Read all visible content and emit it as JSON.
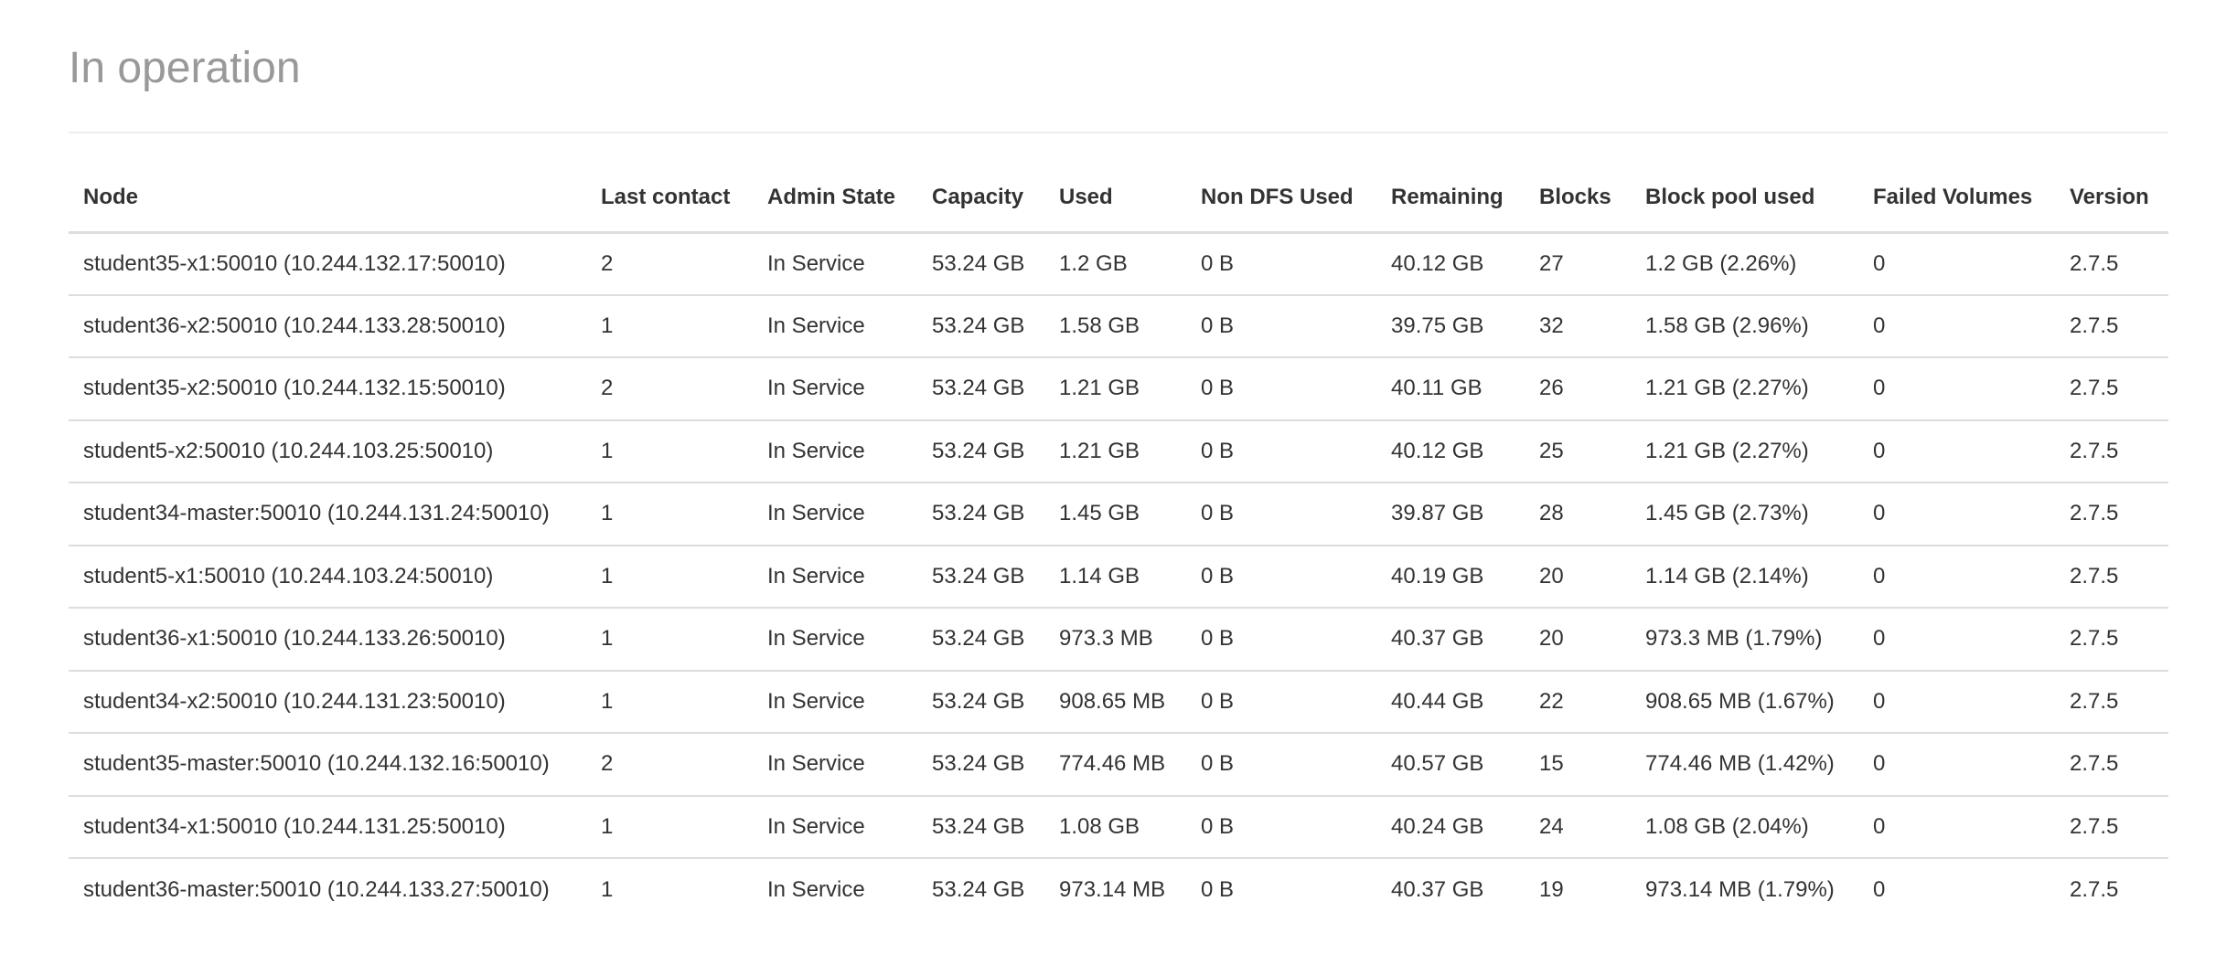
{
  "section": {
    "title": "In operation"
  },
  "table": {
    "columns": [
      "Node",
      "Last contact",
      "Admin State",
      "Capacity",
      "Used",
      "Non DFS Used",
      "Remaining",
      "Blocks",
      "Block pool used",
      "Failed Volumes",
      "Version"
    ],
    "rows": [
      [
        "student35-x1:50010 (10.244.132.17:50010)",
        "2",
        "In Service",
        "53.24 GB",
        "1.2 GB",
        "0 B",
        "40.12 GB",
        "27",
        "1.2 GB (2.26%)",
        "0",
        "2.7.5"
      ],
      [
        "student36-x2:50010 (10.244.133.28:50010)",
        "1",
        "In Service",
        "53.24 GB",
        "1.58 GB",
        "0 B",
        "39.75 GB",
        "32",
        "1.58 GB (2.96%)",
        "0",
        "2.7.5"
      ],
      [
        "student35-x2:50010 (10.244.132.15:50010)",
        "2",
        "In Service",
        "53.24 GB",
        "1.21 GB",
        "0 B",
        "40.11 GB",
        "26",
        "1.21 GB (2.27%)",
        "0",
        "2.7.5"
      ],
      [
        "student5-x2:50010 (10.244.103.25:50010)",
        "1",
        "In Service",
        "53.24 GB",
        "1.21 GB",
        "0 B",
        "40.12 GB",
        "25",
        "1.21 GB (2.27%)",
        "0",
        "2.7.5"
      ],
      [
        "student34-master:50010 (10.244.131.24:50010)",
        "1",
        "In Service",
        "53.24 GB",
        "1.45 GB",
        "0 B",
        "39.87 GB",
        "28",
        "1.45 GB (2.73%)",
        "0",
        "2.7.5"
      ],
      [
        "student5-x1:50010 (10.244.103.24:50010)",
        "1",
        "In Service",
        "53.24 GB",
        "1.14 GB",
        "0 B",
        "40.19 GB",
        "20",
        "1.14 GB (2.14%)",
        "0",
        "2.7.5"
      ],
      [
        "student36-x1:50010 (10.244.133.26:50010)",
        "1",
        "In Service",
        "53.24 GB",
        "973.3 MB",
        "0 B",
        "40.37 GB",
        "20",
        "973.3 MB (1.79%)",
        "0",
        "2.7.5"
      ],
      [
        "student34-x2:50010 (10.244.131.23:50010)",
        "1",
        "In Service",
        "53.24 GB",
        "908.65 MB",
        "0 B",
        "40.44 GB",
        "22",
        "908.65 MB (1.67%)",
        "0",
        "2.7.5"
      ],
      [
        "student35-master:50010 (10.244.132.16:50010)",
        "2",
        "In Service",
        "53.24 GB",
        "774.46 MB",
        "0 B",
        "40.57 GB",
        "15",
        "774.46 MB (1.42%)",
        "0",
        "2.7.5"
      ],
      [
        "student34-x1:50010 (10.244.131.25:50010)",
        "1",
        "In Service",
        "53.24 GB",
        "1.08 GB",
        "0 B",
        "40.24 GB",
        "24",
        "1.08 GB (2.04%)",
        "0",
        "2.7.5"
      ],
      [
        "student36-master:50010 (10.244.133.27:50010)",
        "1",
        "In Service",
        "53.24 GB",
        "973.14 MB",
        "0 B",
        "40.37 GB",
        "19",
        "973.14 MB (1.79%)",
        "0",
        "2.7.5"
      ]
    ]
  }
}
